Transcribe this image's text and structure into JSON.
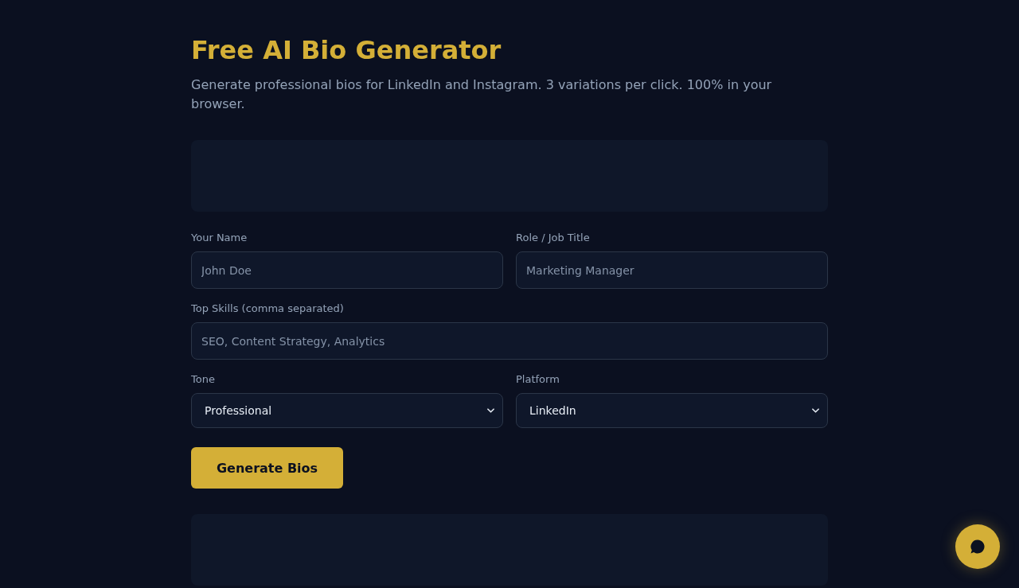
{
  "header": {
    "title": "Free AI Bio Generator",
    "subtitle": "Generate professional bios for LinkedIn and Instagram. 3 variations per click. 100% in your browser."
  },
  "form": {
    "rows": [
      {
        "fields": [
          {
            "kind": "text",
            "label": "Your Name",
            "placeholder": "John Doe"
          },
          {
            "kind": "text",
            "label": "Role / Job Title",
            "placeholder": "Marketing Manager"
          }
        ]
      },
      {
        "fields": [
          {
            "kind": "text",
            "label": "Top Skills (comma separated)",
            "placeholder": "SEO, Content Strategy, Analytics"
          }
        ]
      },
      {
        "fields": [
          {
            "kind": "select",
            "label": "Tone",
            "value": "Professional"
          },
          {
            "kind": "select",
            "label": "Platform",
            "value": "LinkedIn"
          }
        ]
      }
    ],
    "submit_button": {
      "label": "Generate Bios"
    }
  }
}
